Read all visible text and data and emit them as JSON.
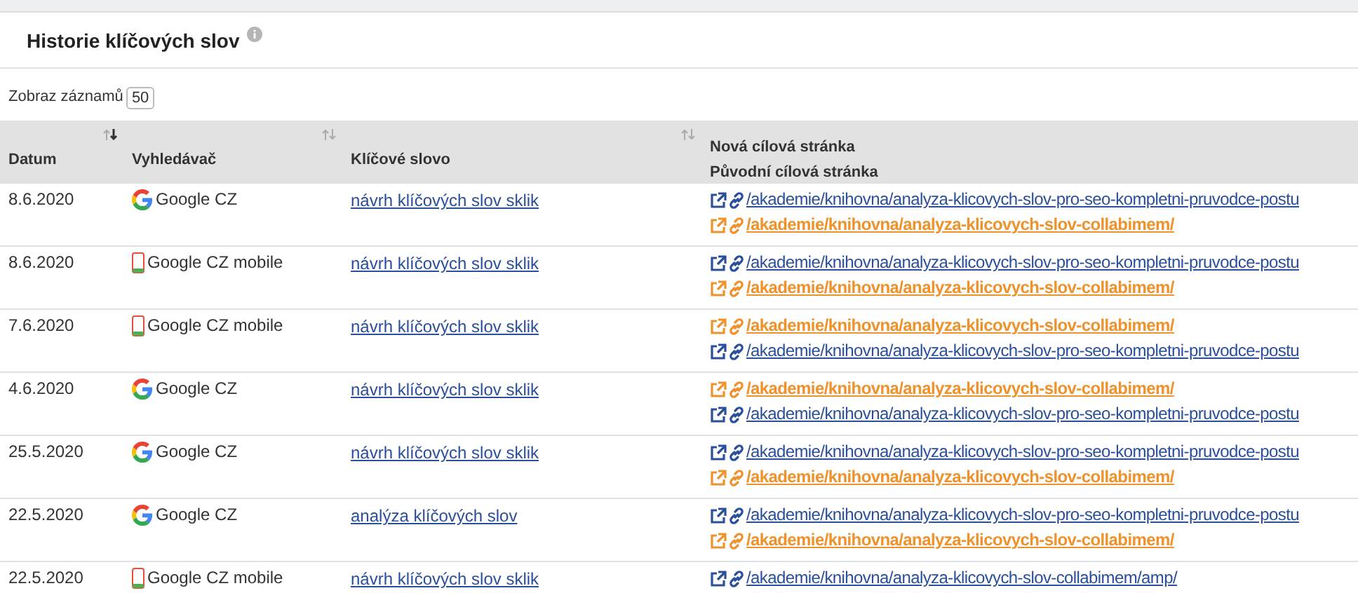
{
  "panel": {
    "title": "Historie klíčových slov"
  },
  "page_size": {
    "label": "Zobraz záznamů",
    "value": "50"
  },
  "table": {
    "columns": [
      {
        "label": "Datum",
        "sorted": true
      },
      {
        "label": "Vyhledávač",
        "sorted": false
      },
      {
        "label": "Klíčové slovo",
        "sorted": false
      },
      {
        "label": "Nová cílová stránka",
        "sublabel": "Původní cílová stránka"
      }
    ],
    "rows": [
      {
        "date": "8.6.2020",
        "engine": {
          "kind": "desktop",
          "name": "Google CZ"
        },
        "keyword": "návrh klíčových slov sklik",
        "urls": [
          {
            "text": "/akademie/knihovna/analyza-klicovych-slov-pro-seo-kompletni-pruvodce-postu",
            "highlighted": false
          },
          {
            "text": "/akademie/knihovna/analyza-klicovych-slov-collabimem/",
            "highlighted": true
          }
        ]
      },
      {
        "date": "8.6.2020",
        "engine": {
          "kind": "mobile",
          "name": "Google CZ mobile"
        },
        "keyword": "návrh klíčových slov sklik",
        "urls": [
          {
            "text": "/akademie/knihovna/analyza-klicovych-slov-pro-seo-kompletni-pruvodce-postu",
            "highlighted": false
          },
          {
            "text": "/akademie/knihovna/analyza-klicovych-slov-collabimem/",
            "highlighted": true
          }
        ]
      },
      {
        "date": "7.6.2020",
        "engine": {
          "kind": "mobile",
          "name": "Google CZ mobile"
        },
        "keyword": "návrh klíčových slov sklik",
        "urls": [
          {
            "text": "/akademie/knihovna/analyza-klicovych-slov-collabimem/",
            "highlighted": true
          },
          {
            "text": "/akademie/knihovna/analyza-klicovych-slov-pro-seo-kompletni-pruvodce-postu",
            "highlighted": false
          }
        ]
      },
      {
        "date": "4.6.2020",
        "engine": {
          "kind": "desktop",
          "name": "Google CZ"
        },
        "keyword": "návrh klíčových slov sklik",
        "urls": [
          {
            "text": "/akademie/knihovna/analyza-klicovych-slov-collabimem/",
            "highlighted": true
          },
          {
            "text": "/akademie/knihovna/analyza-klicovych-slov-pro-seo-kompletni-pruvodce-postu",
            "highlighted": false
          }
        ]
      },
      {
        "date": "25.5.2020",
        "engine": {
          "kind": "desktop",
          "name": "Google CZ"
        },
        "keyword": "návrh klíčových slov sklik",
        "urls": [
          {
            "text": "/akademie/knihovna/analyza-klicovych-slov-pro-seo-kompletni-pruvodce-postu",
            "highlighted": false
          },
          {
            "text": "/akademie/knihovna/analyza-klicovych-slov-collabimem/",
            "highlighted": true
          }
        ]
      },
      {
        "date": "22.5.2020",
        "engine": {
          "kind": "desktop",
          "name": "Google CZ"
        },
        "keyword": "analýza klíčových slov",
        "urls": [
          {
            "text": "/akademie/knihovna/analyza-klicovych-slov-pro-seo-kompletni-pruvodce-postu",
            "highlighted": false
          },
          {
            "text": "/akademie/knihovna/analyza-klicovych-slov-collabimem/",
            "highlighted": true
          }
        ]
      },
      {
        "date": "22.5.2020",
        "engine": {
          "kind": "mobile",
          "name": "Google CZ mobile"
        },
        "keyword": "návrh klíčových slov sklik",
        "urls": [
          {
            "text": "/akademie/knihovna/analyza-klicovych-slov-collabimem/amp/",
            "highlighted": false
          }
        ]
      }
    ]
  }
}
